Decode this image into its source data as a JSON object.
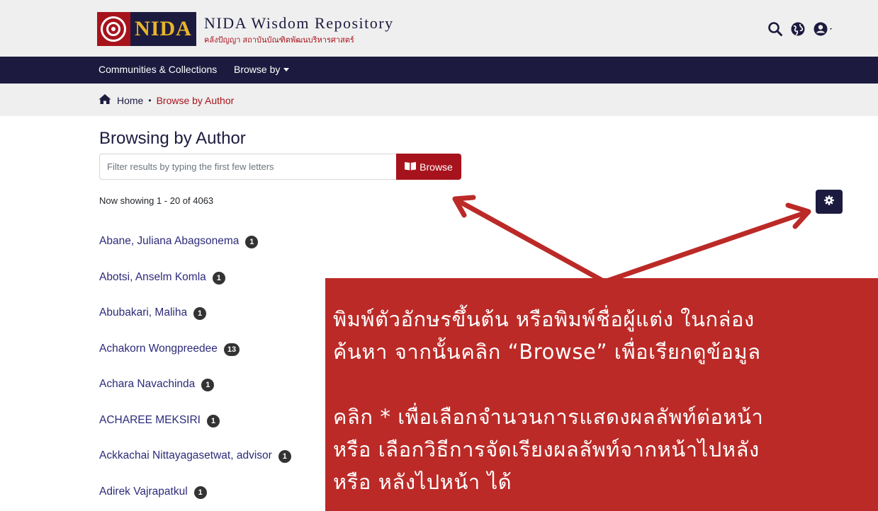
{
  "header": {
    "logo_text": "NIDA",
    "site_title": "NIDA Wisdom Repository",
    "site_subtitle": "คลังปัญญา สถาบันบัณฑิตพัฒนบริหารศาสตร์",
    "icons": [
      "search-icon",
      "globe-icon",
      "user-icon"
    ]
  },
  "nav": {
    "items": [
      {
        "label": "Communities & Collections"
      },
      {
        "label": "Browse by"
      }
    ]
  },
  "breadcrumb": {
    "home": "Home",
    "separator": "•",
    "current": "Browse by Author"
  },
  "main": {
    "title": "Browsing by Author",
    "search_placeholder": "Filter results by typing the first few letters",
    "browse_label": "Browse",
    "showing_text": "Now showing 1 - 20 of 4063",
    "authors": [
      {
        "name": "Abane, Juliana Abagsonema",
        "count": "1"
      },
      {
        "name": "Abotsi, Anselm Komla",
        "count": "1"
      },
      {
        "name": "Abubakari, Maliha",
        "count": "1"
      },
      {
        "name": "Achakorn Wongpreedee",
        "count": "13"
      },
      {
        "name": "Achara Navachinda",
        "count": "1"
      },
      {
        "name": "ACHAREE MEKSIRI",
        "count": "1"
      },
      {
        "name": "Ackkachai Nittayagasetwat, advisor",
        "count": "1"
      },
      {
        "name": "Adirek Vajrapatkul",
        "count": "1"
      }
    ]
  },
  "annotation": {
    "lines": [
      "พิมพ์ตัวอักษรขึ้นต้น หรือพิมพ์ชื่อผู้แต่ง ในกล่อง",
      "ค้นหา จากนั้นคลิก “Browse” เพื่อเรียกดูข้อมูล",
      "คลิก * เพื่อเลือกจำนวนการแสดงผลลัพท์ต่อหน้า",
      "หรือ เลือกวิธีการจัดเรียงผลลัพท์จากหน้าไปหลัง",
      "หรือ หลังไปหน้า ได้"
    ],
    "color": "#bb2a27"
  },
  "colors": {
    "brand_navy": "#1c1b3f",
    "brand_red": "#a7131c",
    "link": "#2d2a7a"
  }
}
